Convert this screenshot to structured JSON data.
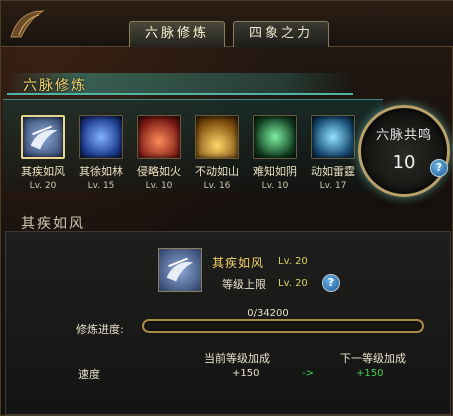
{
  "tabs": [
    "六脉修炼",
    "四象之力"
  ],
  "banner_title": "六脉修炼",
  "orb": {
    "title": "六脉共鸣",
    "value": "10"
  },
  "help_label": "?",
  "skills": [
    {
      "name": "其疾如风",
      "level": "Lv. 20",
      "icon": "wind-swirl-icon",
      "color": "#2b3f66"
    },
    {
      "name": "其徐如林",
      "level": "Lv. 15",
      "icon": "blue-lotus-icon",
      "color": "#1d3a8c"
    },
    {
      "name": "侵略如火",
      "level": "Lv. 10",
      "icon": "red-flame-icon",
      "color": "#7a1a14"
    },
    {
      "name": "不动如山",
      "level": "Lv. 16",
      "icon": "mountain-aura-icon",
      "color": "#7a4a0c"
    },
    {
      "name": "难知如阴",
      "level": "Lv. 10",
      "icon": "green-shadow-icon",
      "color": "#123f22"
    },
    {
      "name": "动如雷霆",
      "level": "Lv. 17",
      "icon": "thunder-armor-icon",
      "color": "#16476f"
    }
  ],
  "detail": {
    "section_title": "其疾如风",
    "name": "其疾如风",
    "level": "Lv. 20",
    "limit_label": "等级上限",
    "limit_value": "Lv. 20",
    "progress_text": "0/34200",
    "progress_label": "修炼进度:",
    "progress_fraction": 0.0,
    "current_header": "当前等级加成",
    "next_header": "下一等级加成",
    "stat_label": "速度",
    "current_value": "+150",
    "arrow": "->",
    "next_value": "+150"
  }
}
